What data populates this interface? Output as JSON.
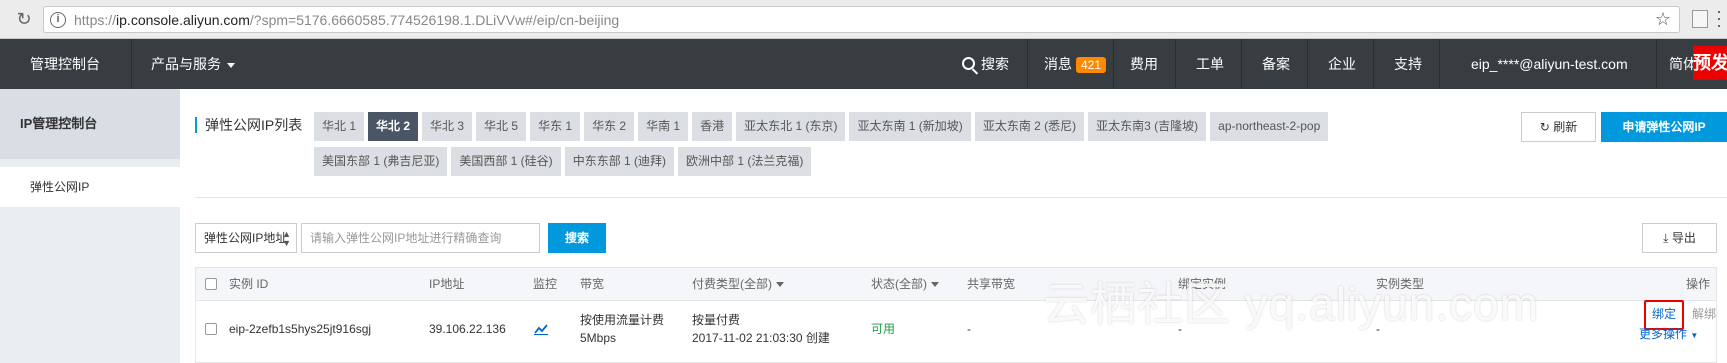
{
  "browser": {
    "url_prefix": "https://",
    "url_host": "ip.console.aliyun.com",
    "url_rest": "/?spm=5176.6660585.774526198.1.DLiVVw#/eip/cn-beijing"
  },
  "topnav": {
    "console": "管理控制台",
    "products": "产品与服务",
    "search": "搜索",
    "messages": "消息",
    "message_count": "421",
    "billing": "费用",
    "tickets": "工单",
    "filing": "备案",
    "enterprise": "企业",
    "support": "支持",
    "account": "eip_****@aliyun-test.com",
    "language": "简体",
    "preview_tag": "预发"
  },
  "sidebar": {
    "title": "IP管理控制台",
    "items": [
      "弹性公网IP"
    ]
  },
  "main": {
    "title": "弹性公网IP列表",
    "regions": [
      "华北 1",
      "华北 2",
      "华北 3",
      "华北 5",
      "华东 1",
      "华东 2",
      "华南 1",
      "香港",
      "亚太东北 1 (东京)",
      "亚太东南 1 (新加坡)",
      "亚太东南 2 (悉尼)",
      "亚太东南3 (吉隆坡)",
      "ap-northeast-2-pop",
      "美国东部 1 (弗吉尼亚)",
      "美国西部 1 (硅谷)",
      "中东东部 1 (迪拜)",
      "欧洲中部 1 (法兰克福)"
    ],
    "active_region": "华北 2",
    "refresh_label": "刷新",
    "apply_label": "申请弹性公网IP",
    "filter_select": "弹性公网IP地址",
    "search_placeholder": "请输入弹性公网IP地址进行精确查询",
    "search_btn": "搜索",
    "export_label": "导出"
  },
  "table": {
    "headers": {
      "instance_id": "实例 ID",
      "ip": "IP地址",
      "monitor": "监控",
      "bandwidth": "带宽",
      "billing": "付费类型(全部)",
      "status": "状态(全部)",
      "shared_bw": "共享带宽",
      "bound_instance": "绑定实例",
      "instance_type": "实例类型",
      "actions": "操作"
    },
    "rows": [
      {
        "instance_id": "eip-2zefb1s5hys25jt916sgj",
        "ip": "39.106.22.136",
        "bandwidth_line1": "按使用流量计费",
        "bandwidth_line2": "5Mbps",
        "billing_line1": "按量付费",
        "billing_line2": "2017-11-02 21:03:30 创建",
        "status": "可用",
        "shared_bw": "-",
        "bound_instance": "-",
        "instance_type": "-",
        "action_bind": "绑定",
        "action_unbind": "解绑",
        "action_more": "更多操作"
      }
    ]
  },
  "watermark": "云栖社区 yq.aliyun.com",
  "colors": {
    "nav_bg": "#373d41",
    "primary": "#0099dd",
    "highlight_box": "#ee0000",
    "status_ok": "#1e9e4a"
  }
}
